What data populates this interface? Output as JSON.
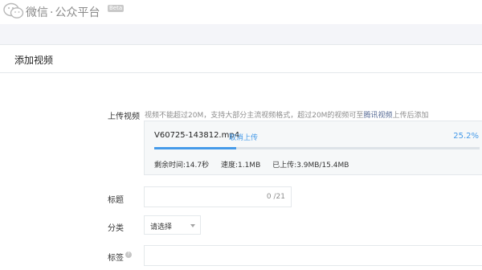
{
  "header": {
    "brand_main": "微信",
    "brand_separator": "·",
    "brand_sub": "公众平台",
    "beta_badge": "Beta",
    "logo_icon": "wechat-bubbles-icon"
  },
  "page": {
    "title": "添加视频"
  },
  "upload": {
    "label": "上传视频",
    "hint_before": "视频不能超过20M，支持大部分主流视频格式，超过20M的视频可至",
    "hint_link": "腾讯视频",
    "hint_after": "上传后添加",
    "filename": "V60725-143812.mp4",
    "cancel_label": "取消上传",
    "percent_text": "25.2%",
    "progress": 0.252,
    "remaining": "剩余时间:14.7秒",
    "speed": "速度:1.1MB",
    "uploaded": "已上传:3.9MB/15.4MB",
    "accent_color": "#459ae9"
  },
  "form": {
    "title_label": "标题",
    "title_value": "",
    "title_counter": "0 /21",
    "category_label": "分类",
    "category_selected": "请选择",
    "tag_label": "标签",
    "tag_help_icon": "question-circle-icon",
    "tag_help_glyph": "?",
    "tag_value": ""
  }
}
